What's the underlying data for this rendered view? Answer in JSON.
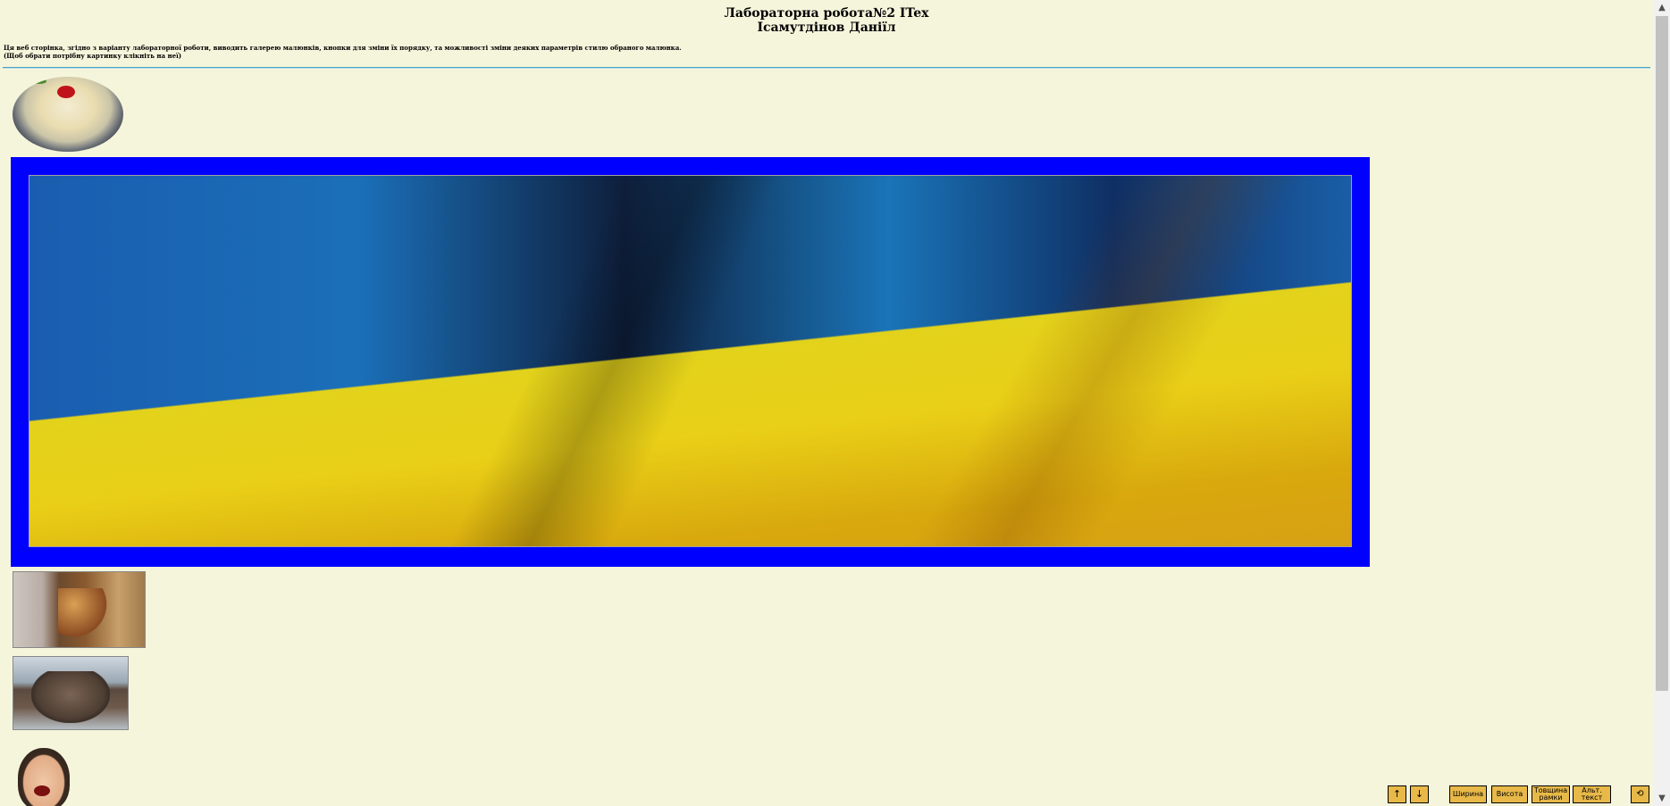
{
  "header": {
    "title_line1": "Лабораторна робота№2 ITex",
    "title_line2": "Ісамутдінов Даніїл",
    "description_line1": "Ця веб сторінка, згідно з варіанту лабораторної роботи, виводить галерею малюнків, кнопки для зміни їх порядку, та можливості зміни деяких параметрів стилю обраного малюнка.",
    "description_line2": "(Щоб обрати потрібну картинку клікніть на неї)"
  },
  "gallery": {
    "selected_border_color": "#0000ff",
    "items": [
      {
        "id": "dumplings",
        "icon": "dumplings-image"
      },
      {
        "id": "ukraine-flag",
        "icon": "ukraine-flag-image",
        "selected": true
      },
      {
        "id": "cat-cathedral",
        "icon": "cat-cathedral-image"
      },
      {
        "id": "elephant-seal",
        "icon": "elephant-seal-image"
      },
      {
        "id": "mr-bean",
        "icon": "mr-bean-image"
      }
    ]
  },
  "controls": {
    "move_up": "↑",
    "move_down": "↓",
    "width": "Ширина",
    "height": "Висота",
    "border_thickness_line1": "Товщина",
    "border_thickness_line2": "рамки",
    "alt_text_line1": "Альт.",
    "alt_text_line2": "текст",
    "reset": "⟲",
    "button_color": "#e8b948"
  },
  "colors": {
    "page_background": "#f5f5dc",
    "divider": "#4aa3c0"
  }
}
